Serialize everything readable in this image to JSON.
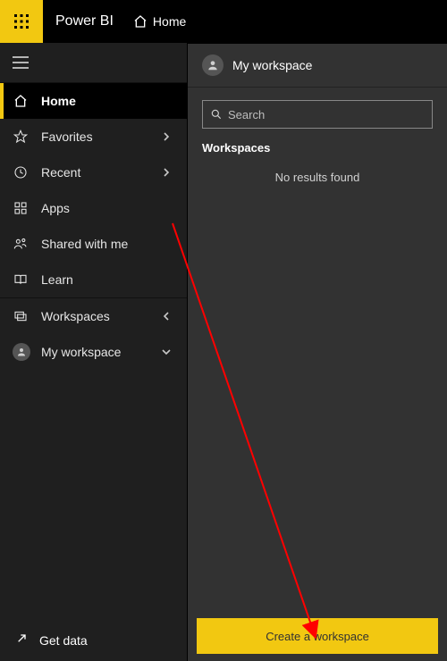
{
  "topbar": {
    "brand": "Power BI",
    "breadcrumb": "Home"
  },
  "nav": {
    "sections": {
      "primary": [
        {
          "icon": "home",
          "label": "Home",
          "chevron": null,
          "active": true
        },
        {
          "icon": "star",
          "label": "Favorites",
          "chevron": "right",
          "active": false
        },
        {
          "icon": "clock",
          "label": "Recent",
          "chevron": "right",
          "active": false
        },
        {
          "icon": "apps",
          "label": "Apps",
          "chevron": null,
          "active": false
        },
        {
          "icon": "shared",
          "label": "Shared with me",
          "chevron": null,
          "active": false
        },
        {
          "icon": "learn",
          "label": "Learn",
          "chevron": null,
          "active": false
        }
      ],
      "secondary": [
        {
          "icon": "workspaces",
          "label": "Workspaces",
          "chevron": "left",
          "active": false
        },
        {
          "icon": "avatar",
          "label": "My workspace",
          "chevron": "down",
          "active": false
        }
      ]
    },
    "footer": {
      "label": "Get data"
    }
  },
  "panel": {
    "title": "My workspace",
    "search_placeholder": "Search",
    "section_label": "Workspaces",
    "empty_text": "No results found",
    "create_button": "Create a workspace"
  }
}
